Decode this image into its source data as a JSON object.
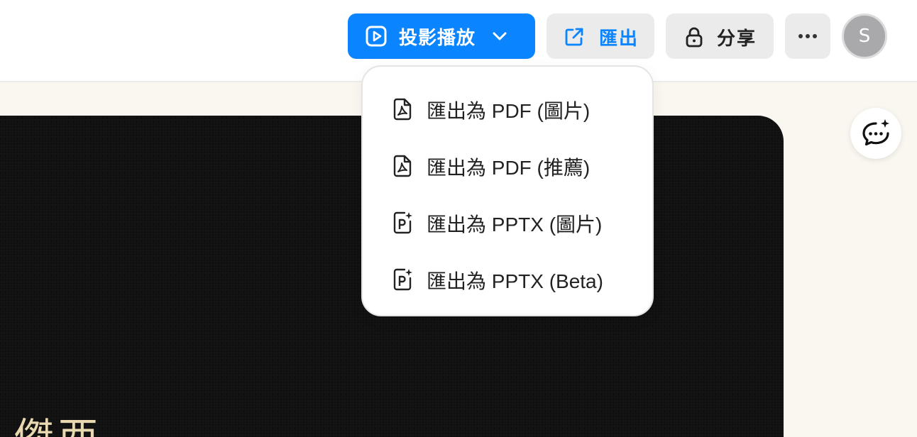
{
  "header": {
    "present_label": "投影播放",
    "export_label": "匯出",
    "share_label": "分享",
    "avatar_initial": "S"
  },
  "export_menu": {
    "items": [
      {
        "label": "匯出為 PDF (圖片)",
        "icon": "pdf-file-icon"
      },
      {
        "label": "匯出為 PDF (推薦)",
        "icon": "pdf-file-icon"
      },
      {
        "label": "匯出為 PPTX (圖片)",
        "icon": "pptx-file-icon"
      },
      {
        "label": "匯出為 PPTX (Beta)",
        "icon": "pptx-file-icon"
      }
    ]
  },
  "slide": {
    "partial_text": "傑西"
  },
  "colors": {
    "accent": "#0a84ff",
    "button_gray": "#ebebeb",
    "canvas_bg": "#faf6f0",
    "slide_bg": "#111111",
    "slide_text": "#e9d8b0"
  }
}
